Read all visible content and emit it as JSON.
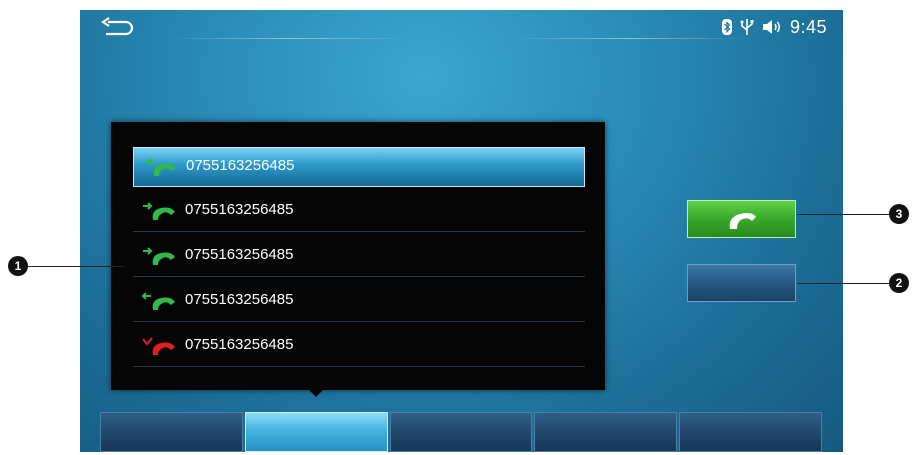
{
  "status_bar": {
    "time": "9:45",
    "icons": [
      "back-arrow-icon",
      "bluetooth-icon",
      "usb-icon",
      "volume-icon"
    ]
  },
  "call_log": {
    "entries": [
      {
        "number": "0755163256485",
        "type": "outgoing",
        "icon_color": "#33b84a",
        "selected": true
      },
      {
        "number": "0755163256485",
        "type": "outgoing",
        "icon_color": "#33b84a",
        "selected": false
      },
      {
        "number": "0755163256485",
        "type": "outgoing",
        "icon_color": "#33b84a",
        "selected": false
      },
      {
        "number": "0755163256485",
        "type": "incoming",
        "icon_color": "#33b84a",
        "selected": false
      },
      {
        "number": "0755163256485",
        "type": "missed",
        "icon_color": "#e02020",
        "selected": false
      }
    ]
  },
  "actions": {
    "call_icon": "phone-handset-icon",
    "call_color": "#3aa82b"
  },
  "tabs": {
    "count": 5,
    "active_index": 1
  },
  "callouts": {
    "list": "1",
    "blank_button": "2",
    "call_button": "3"
  },
  "colors": {
    "screen_bg": "#2a8db8",
    "panel_bg": "#050505",
    "highlight": "#2c97c8"
  }
}
